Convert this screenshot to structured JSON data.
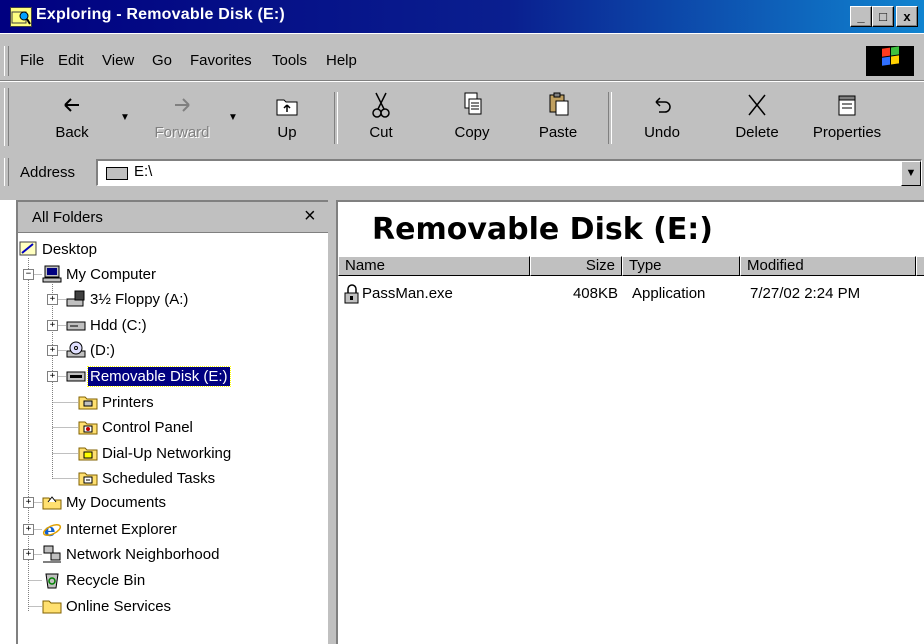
{
  "window": {
    "title": "Exploring - Removable Disk (E:)",
    "min": "_",
    "max": "□",
    "close": "x"
  },
  "menu": {
    "items": [
      "File",
      "Edit",
      "View",
      "Go",
      "Favorites",
      "Tools",
      "Help"
    ]
  },
  "toolbar": {
    "back": "Back",
    "forward": "Forward",
    "up": "Up",
    "cut": "Cut",
    "copy": "Copy",
    "paste": "Paste",
    "undo": "Undo",
    "delete": "Delete",
    "properties": "Properties",
    "dropdown": "▼"
  },
  "address": {
    "label": "Address",
    "value": "E:\\",
    "dropdown": "▼"
  },
  "folders": {
    "title": "All Folders",
    "close": "×",
    "items": [
      {
        "label": "Desktop",
        "icon": "desktop-icon"
      },
      {
        "label": "My Computer",
        "icon": "my-computer-icon",
        "expander": "−"
      },
      {
        "label": "3½ Floppy (A:)",
        "icon": "floppy-drive-icon",
        "expander": "+"
      },
      {
        "label": "Hdd (C:)",
        "icon": "hard-drive-icon",
        "expander": "+"
      },
      {
        "label": " (D:)",
        "icon": "cd-drive-icon",
        "expander": "+"
      },
      {
        "label": "Removable Disk (E:)",
        "icon": "removable-disk-icon",
        "expander": "+",
        "selected": true
      },
      {
        "label": "Printers",
        "icon": "printers-folder-icon"
      },
      {
        "label": "Control Panel",
        "icon": "control-panel-folder-icon"
      },
      {
        "label": "Dial-Up Networking",
        "icon": "dialup-folder-icon"
      },
      {
        "label": "Scheduled Tasks",
        "icon": "scheduled-tasks-folder-icon"
      },
      {
        "label": "My Documents",
        "icon": "my-documents-icon",
        "expander": "+"
      },
      {
        "label": "Internet Explorer",
        "icon": "internet-explorer-icon",
        "expander": "+"
      },
      {
        "label": "Network Neighborhood",
        "icon": "network-icon",
        "expander": "+"
      },
      {
        "label": "Recycle Bin",
        "icon": "recycle-bin-icon"
      },
      {
        "label": "Online Services",
        "icon": "folder-icon"
      }
    ]
  },
  "content": {
    "title": "Removable Disk (E:)",
    "columns": [
      "Name",
      "Size",
      "Type",
      "Modified"
    ],
    "files": [
      {
        "name": "PassMan.exe",
        "size": "408KB",
        "type": "Application",
        "modified": "7/27/02 2:24 PM",
        "icon": "application-exe-icon"
      }
    ]
  },
  "colors": {
    "title_bar": "#000080",
    "face": "#c0c0c0",
    "selection": "#000080"
  }
}
